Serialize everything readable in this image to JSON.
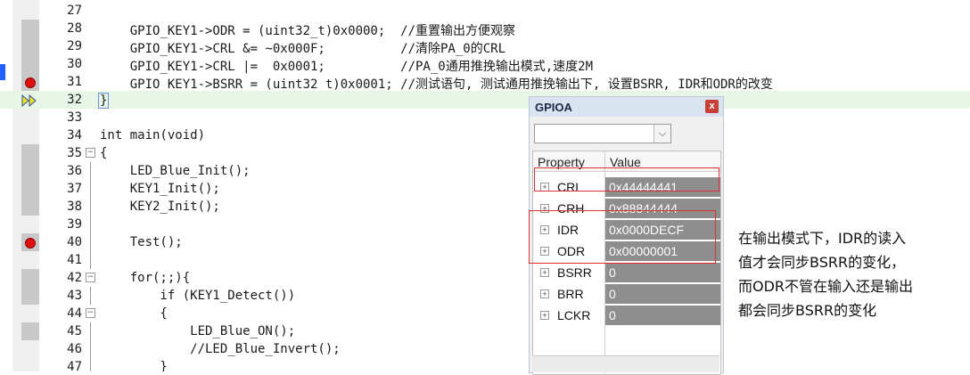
{
  "editor": {
    "lines": [
      {
        "num": "27",
        "code": ""
      },
      {
        "num": "28",
        "code": "    GPIO_KEY1->ODR = (uint32_t)0x0000;  //重置输出方便观察"
      },
      {
        "num": "29",
        "code": "    GPIO_KEY1->CRL &= ~0x000F;          //清除PA_0的CRL"
      },
      {
        "num": "30",
        "code": "    GPIO_KEY1->CRL |=  0x0001;          //PA_0通用推挽输出模式,速度2M"
      },
      {
        "num": "31",
        "code": "    GPIO_KEY1->BSRR = (uint32_t)0x0001; //测试语句, 测试通用推挽输出下, 设置BSRR, IDR和ODR的改变"
      },
      {
        "num": "32",
        "code": "}"
      },
      {
        "num": "33",
        "code": ""
      },
      {
        "num": "34",
        "code": "int main(void)"
      },
      {
        "num": "35",
        "code": "{"
      },
      {
        "num": "36",
        "code": "    LED_Blue_Init();"
      },
      {
        "num": "37",
        "code": "    KEY1_Init();"
      },
      {
        "num": "38",
        "code": "    KEY2_Init();"
      },
      {
        "num": "39",
        "code": ""
      },
      {
        "num": "40",
        "code": "    Test();"
      },
      {
        "num": "41",
        "code": ""
      },
      {
        "num": "42",
        "code": "    for(;;){"
      },
      {
        "num": "43",
        "code": "        if (KEY1_Detect())"
      },
      {
        "num": "44",
        "code": "        {"
      },
      {
        "num": "45",
        "code": "            LED_Blue_ON();"
      },
      {
        "num": "46",
        "code": "            //LED_Blue_Invert();"
      },
      {
        "num": "47",
        "code": "        }"
      }
    ]
  },
  "panel": {
    "title": "GPIOA",
    "close": "x",
    "dropdown_arrow": "⌵",
    "col_property": "Property",
    "col_value": "Value",
    "rows": [
      {
        "name": "CRL",
        "value": "0x44444441"
      },
      {
        "name": "CRH",
        "value": "0x88844444"
      },
      {
        "name": "IDR",
        "value": "0x0000DECF"
      },
      {
        "name": "ODR",
        "value": "0x00000001"
      },
      {
        "name": "BSRR",
        "value": "0"
      },
      {
        "name": "BRR",
        "value": "0"
      },
      {
        "name": "LCKR",
        "value": "0"
      }
    ]
  },
  "annotation": {
    "line1": "在输出模式下，IDR的读入",
    "line2": "值才会同步BSRR的变化，",
    "line3": "而ODR不管在输入还是输出",
    "line4": "都会同步BSRR的变化"
  },
  "colors": {
    "current_line": "#e8f6e8",
    "breakpoint": "#e01010",
    "comment": "#18a018",
    "keyword": "#2020d0",
    "value_cell": "#8e8e8e"
  }
}
